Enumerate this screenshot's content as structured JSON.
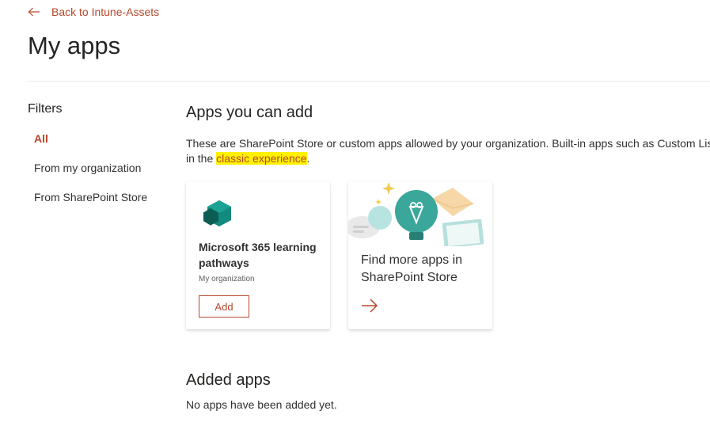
{
  "header": {
    "back_label": "Back to Intune-Assets",
    "title": "My apps"
  },
  "filters": {
    "title": "Filters",
    "items": [
      {
        "label": "All",
        "active": true
      },
      {
        "label": "From my organization",
        "active": false
      },
      {
        "label": "From SharePoint Store",
        "active": false
      }
    ]
  },
  "apps_section": {
    "title": "Apps you can add",
    "description_line1": "These are SharePoint Store or custom apps allowed by your organization. Built-in apps such as Custom List,",
    "description_line2_prefix": "in the ",
    "description_link": "classic experience",
    "description_line2_suffix": "."
  },
  "app_card": {
    "name": "Microsoft 365 learning pathways",
    "source": "My organization",
    "add_label": "Add"
  },
  "store_card": {
    "title": "Find more apps in SharePoint Store"
  },
  "added_section": {
    "title": "Added apps",
    "empty_message": "No apps have been added yet."
  },
  "colors": {
    "accent": "#b7472a",
    "highlight": "#fff100",
    "text": "#323130",
    "icon_teal": "#0b6a5f"
  },
  "icons": [
    "arrow-left-icon",
    "learning-pathways-app-icon",
    "lightbulb-illustration",
    "arrow-right-icon"
  ]
}
